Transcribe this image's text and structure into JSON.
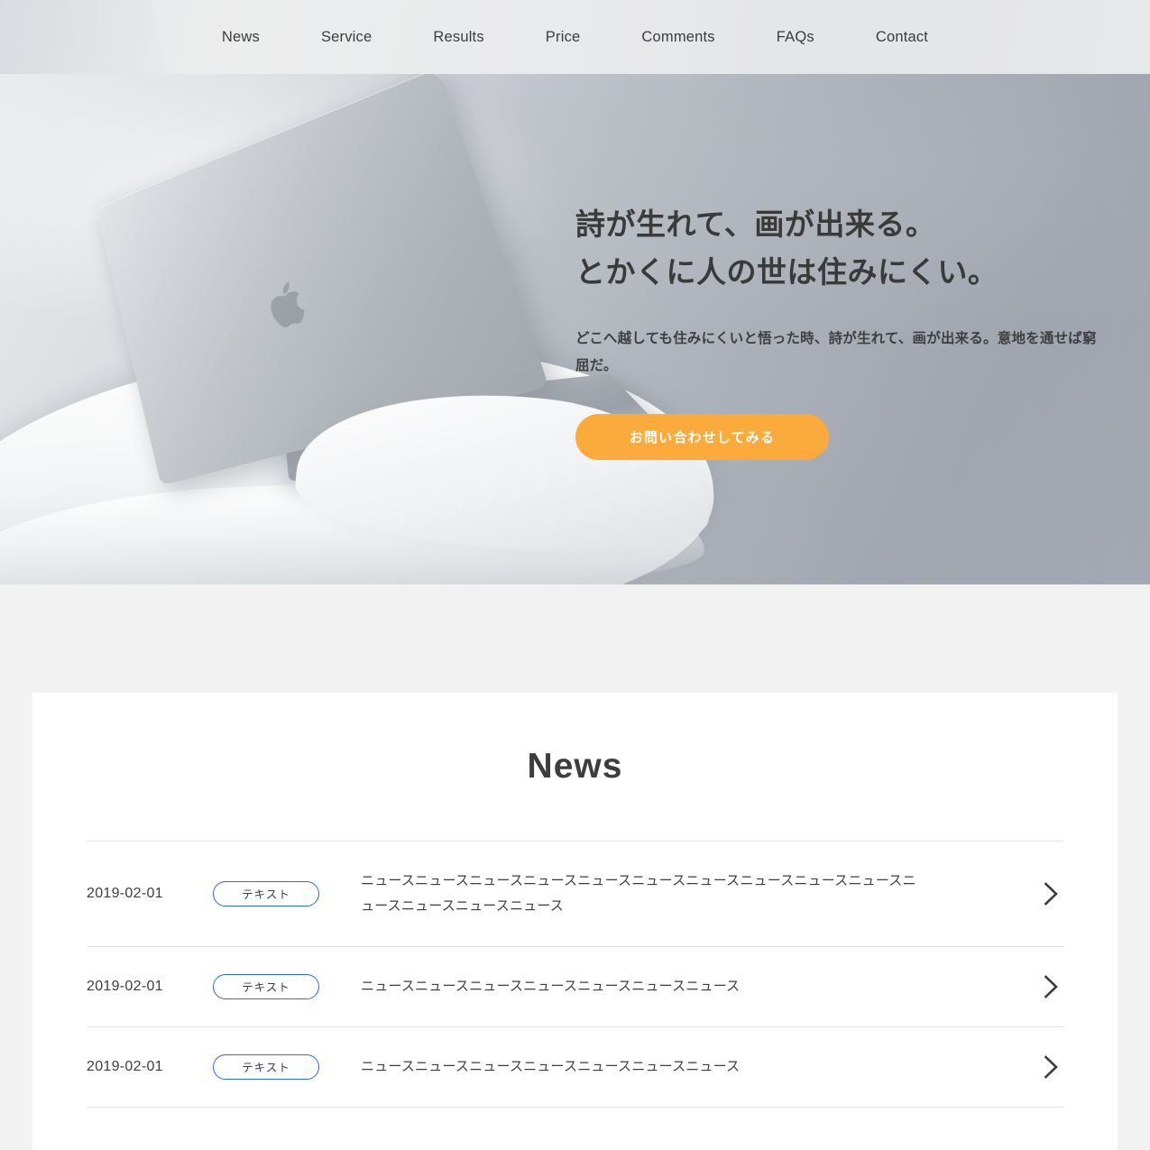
{
  "header": {
    "nav_items": [
      {
        "label": "News",
        "name": "nav-item-news"
      },
      {
        "label": "Service",
        "name": "nav-item-service"
      },
      {
        "label": "Results",
        "name": "nav-item-results"
      },
      {
        "label": "Price",
        "name": "nav-item-price"
      },
      {
        "label": "Comments",
        "name": "nav-item-comments"
      },
      {
        "label": "FAQs",
        "name": "nav-item-faqs"
      },
      {
        "label": "Contact",
        "name": "nav-item-contact"
      }
    ]
  },
  "hero": {
    "title_line1": "詩が生れて、画が出来る。",
    "title_line2": "とかくに人の世は住みにくい。",
    "description": "どこへ越しても住みにくいと悟った時、詩が生れて、画が出来る。意地を通せば窮屈だ。",
    "cta_label": "お問い合わせしてみる",
    "image_alt": "silver-macbook-laptop-on-white-chair",
    "colors": {
      "cta_background": "#fbaa3c",
      "cta_text": "#ffffff",
      "backdrop": "#aeb3bb",
      "heading_text": "#3a3a3a"
    }
  },
  "news": {
    "heading": "News",
    "arrow_icon": "chevron-right-icon",
    "accent_color": "#2f68e8",
    "items": [
      {
        "date": "2019-02-01",
        "tag": "テキスト",
        "text": "ニュースニュースニュースニュースニュースニュースニュースニュースニュースニュースニュースニュースニュースニュース"
      },
      {
        "date": "2019-02-01",
        "tag": "テキスト",
        "text": "ニュースニュースニュースニュースニュースニュースニュース"
      },
      {
        "date": "2019-02-01",
        "tag": "テキスト",
        "text": "ニュースニュースニュースニュースニュースニュースニュース"
      }
    ]
  }
}
